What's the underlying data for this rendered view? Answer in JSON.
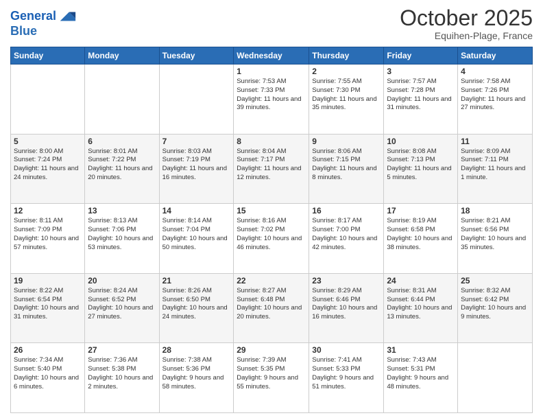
{
  "header": {
    "logo_line1": "General",
    "logo_line2": "Blue",
    "month": "October 2025",
    "location": "Equihen-Plage, France"
  },
  "weekdays": [
    "Sunday",
    "Monday",
    "Tuesday",
    "Wednesday",
    "Thursday",
    "Friday",
    "Saturday"
  ],
  "weeks": [
    [
      {
        "day": "",
        "info": ""
      },
      {
        "day": "",
        "info": ""
      },
      {
        "day": "",
        "info": ""
      },
      {
        "day": "1",
        "info": "Sunrise: 7:53 AM\nSunset: 7:33 PM\nDaylight: 11 hours and 39 minutes."
      },
      {
        "day": "2",
        "info": "Sunrise: 7:55 AM\nSunset: 7:30 PM\nDaylight: 11 hours and 35 minutes."
      },
      {
        "day": "3",
        "info": "Sunrise: 7:57 AM\nSunset: 7:28 PM\nDaylight: 11 hours and 31 minutes."
      },
      {
        "day": "4",
        "info": "Sunrise: 7:58 AM\nSunset: 7:26 PM\nDaylight: 11 hours and 27 minutes."
      }
    ],
    [
      {
        "day": "5",
        "info": "Sunrise: 8:00 AM\nSunset: 7:24 PM\nDaylight: 11 hours and 24 minutes."
      },
      {
        "day": "6",
        "info": "Sunrise: 8:01 AM\nSunset: 7:22 PM\nDaylight: 11 hours and 20 minutes."
      },
      {
        "day": "7",
        "info": "Sunrise: 8:03 AM\nSunset: 7:19 PM\nDaylight: 11 hours and 16 minutes."
      },
      {
        "day": "8",
        "info": "Sunrise: 8:04 AM\nSunset: 7:17 PM\nDaylight: 11 hours and 12 minutes."
      },
      {
        "day": "9",
        "info": "Sunrise: 8:06 AM\nSunset: 7:15 PM\nDaylight: 11 hours and 8 minutes."
      },
      {
        "day": "10",
        "info": "Sunrise: 8:08 AM\nSunset: 7:13 PM\nDaylight: 11 hours and 5 minutes."
      },
      {
        "day": "11",
        "info": "Sunrise: 8:09 AM\nSunset: 7:11 PM\nDaylight: 11 hours and 1 minute."
      }
    ],
    [
      {
        "day": "12",
        "info": "Sunrise: 8:11 AM\nSunset: 7:09 PM\nDaylight: 10 hours and 57 minutes."
      },
      {
        "day": "13",
        "info": "Sunrise: 8:13 AM\nSunset: 7:06 PM\nDaylight: 10 hours and 53 minutes."
      },
      {
        "day": "14",
        "info": "Sunrise: 8:14 AM\nSunset: 7:04 PM\nDaylight: 10 hours and 50 minutes."
      },
      {
        "day": "15",
        "info": "Sunrise: 8:16 AM\nSunset: 7:02 PM\nDaylight: 10 hours and 46 minutes."
      },
      {
        "day": "16",
        "info": "Sunrise: 8:17 AM\nSunset: 7:00 PM\nDaylight: 10 hours and 42 minutes."
      },
      {
        "day": "17",
        "info": "Sunrise: 8:19 AM\nSunset: 6:58 PM\nDaylight: 10 hours and 38 minutes."
      },
      {
        "day": "18",
        "info": "Sunrise: 8:21 AM\nSunset: 6:56 PM\nDaylight: 10 hours and 35 minutes."
      }
    ],
    [
      {
        "day": "19",
        "info": "Sunrise: 8:22 AM\nSunset: 6:54 PM\nDaylight: 10 hours and 31 minutes."
      },
      {
        "day": "20",
        "info": "Sunrise: 8:24 AM\nSunset: 6:52 PM\nDaylight: 10 hours and 27 minutes."
      },
      {
        "day": "21",
        "info": "Sunrise: 8:26 AM\nSunset: 6:50 PM\nDaylight: 10 hours and 24 minutes."
      },
      {
        "day": "22",
        "info": "Sunrise: 8:27 AM\nSunset: 6:48 PM\nDaylight: 10 hours and 20 minutes."
      },
      {
        "day": "23",
        "info": "Sunrise: 8:29 AM\nSunset: 6:46 PM\nDaylight: 10 hours and 16 minutes."
      },
      {
        "day": "24",
        "info": "Sunrise: 8:31 AM\nSunset: 6:44 PM\nDaylight: 10 hours and 13 minutes."
      },
      {
        "day": "25",
        "info": "Sunrise: 8:32 AM\nSunset: 6:42 PM\nDaylight: 10 hours and 9 minutes."
      }
    ],
    [
      {
        "day": "26",
        "info": "Sunrise: 7:34 AM\nSunset: 5:40 PM\nDaylight: 10 hours and 6 minutes."
      },
      {
        "day": "27",
        "info": "Sunrise: 7:36 AM\nSunset: 5:38 PM\nDaylight: 10 hours and 2 minutes."
      },
      {
        "day": "28",
        "info": "Sunrise: 7:38 AM\nSunset: 5:36 PM\nDaylight: 9 hours and 58 minutes."
      },
      {
        "day": "29",
        "info": "Sunrise: 7:39 AM\nSunset: 5:35 PM\nDaylight: 9 hours and 55 minutes."
      },
      {
        "day": "30",
        "info": "Sunrise: 7:41 AM\nSunset: 5:33 PM\nDaylight: 9 hours and 51 minutes."
      },
      {
        "day": "31",
        "info": "Sunrise: 7:43 AM\nSunset: 5:31 PM\nDaylight: 9 hours and 48 minutes."
      },
      {
        "day": "",
        "info": ""
      }
    ]
  ]
}
